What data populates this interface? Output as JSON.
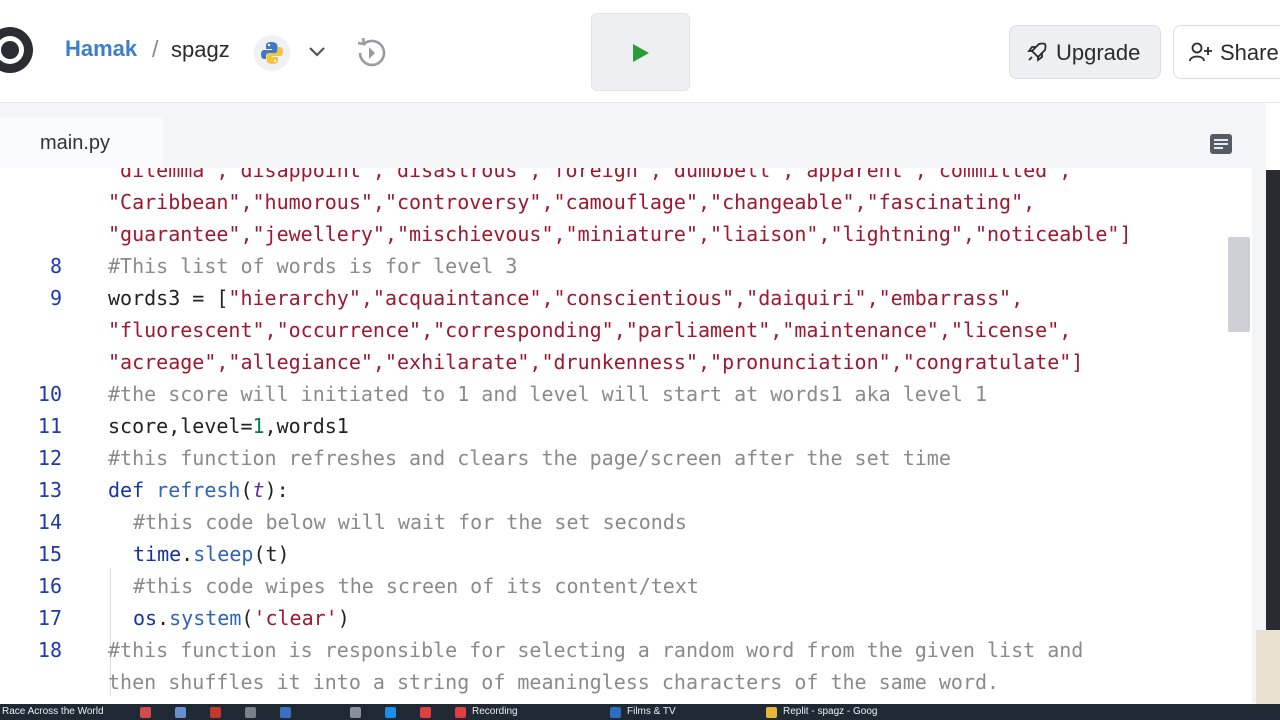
{
  "header": {
    "user": "Hamak",
    "separator": "/",
    "repl_name": "spagz",
    "upgrade_label": "Upgrade",
    "share_label": "Share",
    "run_color": "#2a9a3a"
  },
  "editor": {
    "tab_label": "main.py"
  },
  "code_lines": [
    {
      "num": "",
      "tokens": [
        {
          "t": "\"dilemma\",\"disappoint\",\"disastrous\",\"foreign\",\"dumbbell\",\"apparent\",\"committed\",",
          "c": "s"
        }
      ]
    },
    {
      "num": "",
      "tokens": [
        {
          "t": "\"Caribbean\",\"humorous\",\"controversy\",\"camouflage\",\"changeable\",\"fascinating\",",
          "c": "s"
        }
      ]
    },
    {
      "num": "",
      "tokens": [
        {
          "t": "\"guarantee\",\"jewellery\",\"mischievous\",\"miniature\",\"liaison\",\"lightning\",\"noticeable\"]",
          "c": "s"
        }
      ]
    },
    {
      "num": "8",
      "tokens": [
        {
          "t": "#This list of words is for level 3",
          "c": "c"
        }
      ]
    },
    {
      "num": "9",
      "tokens": [
        {
          "t": "words3 = [",
          "c": "p"
        },
        {
          "t": "\"hierarchy\",\"acquaintance\",\"conscientious\",\"daiquiri\",\"embarrass\",",
          "c": "s"
        }
      ]
    },
    {
      "num": "",
      "tokens": [
        {
          "t": "\"fluorescent\",\"occurrence\",\"corresponding\",\"parliament\",\"maintenance\",\"license\",",
          "c": "s"
        }
      ]
    },
    {
      "num": "",
      "tokens": [
        {
          "t": "\"acreage\",\"allegiance\",\"exhilarate\",\"drunkenness\",\"pronunciation\",\"congratulate\"]",
          "c": "s"
        }
      ]
    },
    {
      "num": "10",
      "tokens": [
        {
          "t": "#the score will initiated to 1 and level will start at words1 aka level 1",
          "c": "c"
        }
      ]
    },
    {
      "num": "11",
      "tokens": [
        {
          "t": "score,level=",
          "c": "p"
        },
        {
          "t": "1",
          "c": "n"
        },
        {
          "t": ",words1",
          "c": "p"
        }
      ]
    },
    {
      "num": "12",
      "tokens": [
        {
          "t": "#this function refreshes and clears the page/screen after the set time",
          "c": "c"
        }
      ]
    },
    {
      "num": "13",
      "tokens": [
        {
          "t": "def ",
          "c": "k"
        },
        {
          "t": "refresh",
          "c": "f"
        },
        {
          "t": "(",
          "c": "p"
        },
        {
          "t": "t",
          "c": "v"
        },
        {
          "t": "):",
          "c": "p"
        }
      ]
    },
    {
      "num": "14",
      "indent": true,
      "tokens": [
        {
          "t": "#this code below will wait for the set seconds",
          "c": "c"
        }
      ]
    },
    {
      "num": "15",
      "indent": true,
      "tokens": [
        {
          "t": "time",
          "c": "k"
        },
        {
          "t": ".",
          "c": "p"
        },
        {
          "t": "sleep",
          "c": "f"
        },
        {
          "t": "(t)",
          "c": "p"
        }
      ]
    },
    {
      "num": "16",
      "indent": true,
      "tokens": [
        {
          "t": "#this code wipes the screen of its content/text",
          "c": "c"
        }
      ]
    },
    {
      "num": "17",
      "indent": true,
      "tokens": [
        {
          "t": "os",
          "c": "k"
        },
        {
          "t": ".",
          "c": "p"
        },
        {
          "t": "system",
          "c": "f"
        },
        {
          "t": "(",
          "c": "p"
        },
        {
          "t": "'clear'",
          "c": "s"
        },
        {
          "t": ")",
          "c": "p"
        }
      ]
    },
    {
      "num": "18",
      "tokens": [
        {
          "t": "#this function is responsible for selecting a random word from the given list and",
          "c": "c"
        }
      ]
    },
    {
      "num": "",
      "tokens": [
        {
          "t": "then shuffles it into a string of meaningless characters of the same word.",
          "c": "c"
        }
      ]
    }
  ],
  "taskbar": {
    "items": [
      "Race Across the World",
      "Recording",
      "Films & TV",
      "Replit - spagz - Goog"
    ]
  }
}
